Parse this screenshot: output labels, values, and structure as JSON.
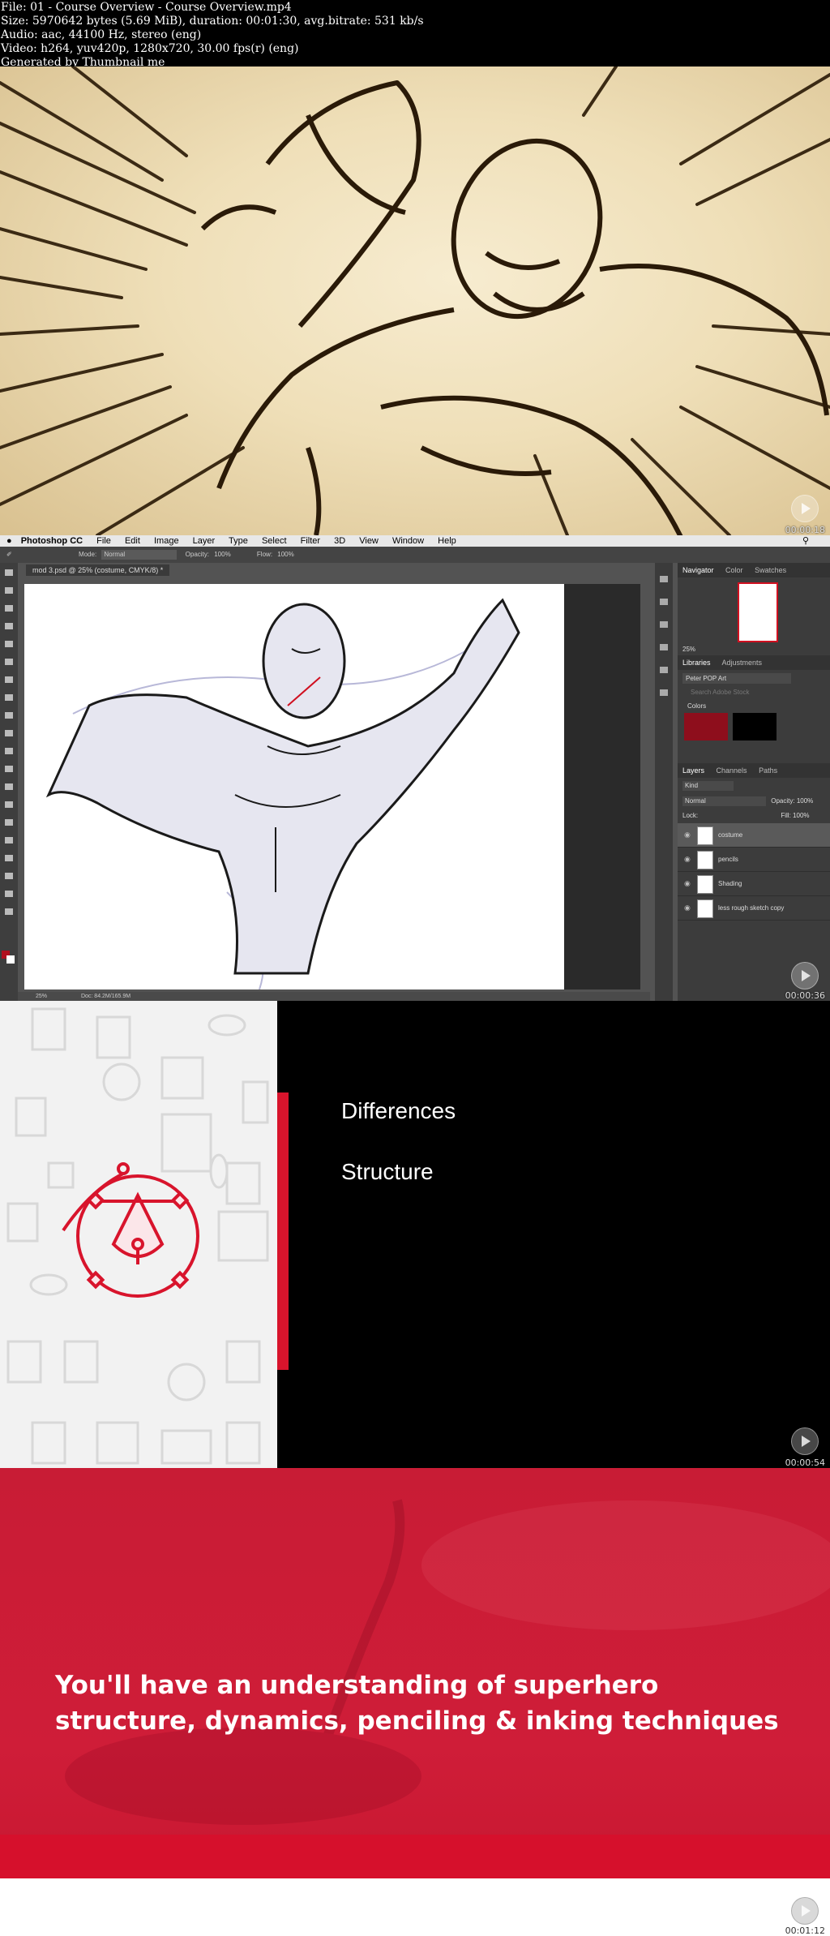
{
  "header": {
    "line1": "File: 01 - Course Overview - Course Overview.mp4",
    "line2": "Size: 5970642 bytes (5.69 MiB), duration: 00:01:30, avg.bitrate: 531 kb/s",
    "line3": "Audio: aac, 44100 Hz, stereo (eng)",
    "line4": "Video: h264, yuv420p, 1280x720, 30.00 fps(r) (eng)",
    "line5": "Generated by Thumbnail me"
  },
  "timestamps": {
    "frame1": "00:00:18",
    "frame2": "00:00:36",
    "frame3": "00:00:54",
    "frame4": "00:01:12"
  },
  "photoshop": {
    "app_name": "Photoshop CC",
    "menu": [
      "File",
      "Edit",
      "Image",
      "Layer",
      "Type",
      "Select",
      "Filter",
      "3D",
      "View",
      "Window",
      "Help"
    ],
    "options": {
      "mode_label": "Mode:",
      "mode_value": "Normal",
      "opacity_label": "Opacity:",
      "opacity_value": "100%",
      "flow_label": "Flow:",
      "flow_value": "100%"
    },
    "doc_tab": "mod 3.psd @ 25% (costume, CMYK/8) *",
    "status_zoom": "25%",
    "status_doc": "Doc: 84.2M/165.9M",
    "navigator_tabs": [
      "Navigator",
      "Color",
      "Swatches"
    ],
    "navigator_zoom": "25%",
    "library_tabs": [
      "Libraries",
      "Adjustments"
    ],
    "library_name": "Peter POP Art",
    "library_search": "Search Adobe Stock",
    "colors_label": "Colors",
    "swatch_colors": [
      "#8e0e1c",
      "#000000"
    ],
    "layer_tabs": [
      "Layers",
      "Channels",
      "Paths"
    ],
    "layer_kind": "Kind",
    "blend_mode": "Normal",
    "opacity_label": "Opacity:",
    "opacity_value": "100%",
    "lock_label": "Lock:",
    "fill_label": "Fill:",
    "fill_value": "100%",
    "layers": [
      "costume",
      "pencils",
      "Shading",
      "less rough sketch copy"
    ]
  },
  "slide": {
    "items": [
      "Differences",
      "Structure"
    ],
    "accent": "#d8142c"
  },
  "outro": {
    "line1": "You'll have an understanding of superhero",
    "line2": "structure, dynamics, penciling & inking techniques"
  }
}
